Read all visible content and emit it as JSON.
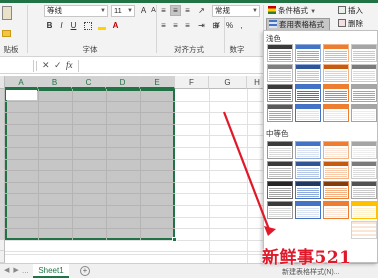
{
  "ribbon": {
    "font_name": "等线",
    "font_size": "11",
    "number_format": "常规",
    "groups": {
      "clipboard": "贴板",
      "font": "字体",
      "alignment": "对齐方式",
      "number": "数字"
    },
    "conditional_format": "条件格式",
    "format_as_table": "套用表格格式",
    "insert": "插入",
    "delete": "删除",
    "paste_glyph": "贴"
  },
  "grid": {
    "columns": [
      "A",
      "B",
      "C",
      "D",
      "E",
      "F",
      "G",
      "H"
    ],
    "selected_columns": [
      "A",
      "B",
      "C",
      "D",
      "E"
    ]
  },
  "gallery": {
    "sections": [
      "浅色",
      "中等色"
    ],
    "new_table_style": "新建表格样式(N)..."
  },
  "sheet": {
    "tab_name": "Sheet1",
    "ellipsis": "...",
    "add_symbol": "+"
  },
  "watermark": "新鲜事521",
  "colors": {
    "excel_green": "#217346",
    "selection_gray": "#c6c6c6",
    "blue": "#4472c4",
    "orange": "#ed7d31",
    "gray": "#a5a5a5",
    "gold": "#ffc000",
    "dark": "#3b3b3b",
    "arrow_red": "#e0192a"
  }
}
